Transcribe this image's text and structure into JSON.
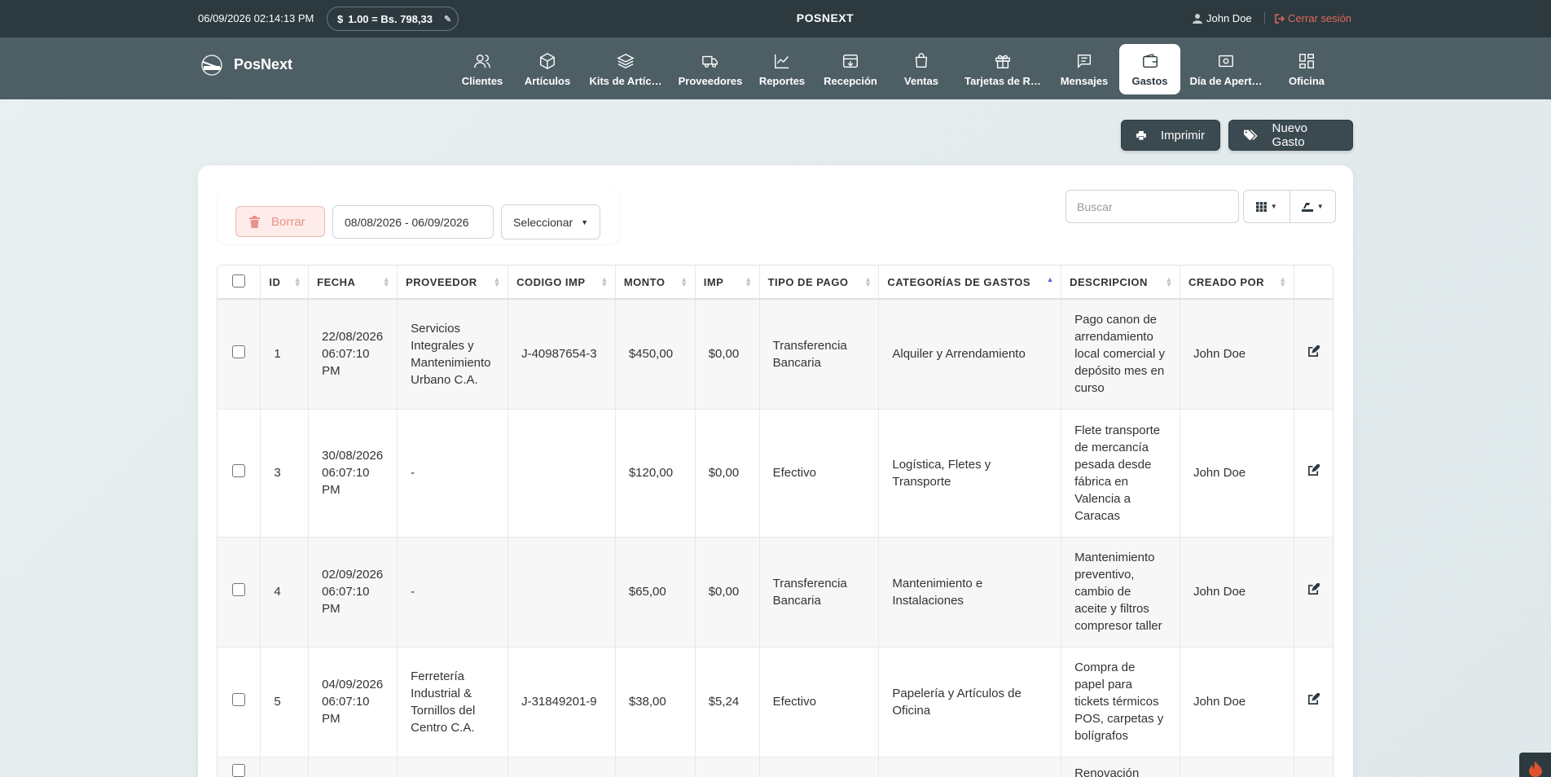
{
  "topbar": {
    "datetime": "06/09/2026 02:14:13 PM",
    "rate_symbol": "$",
    "rate": "1.00 = Bs. 798,33",
    "app_title": "POSNEXT",
    "user_name": "John Doe",
    "logout_label": "Cerrar sesión"
  },
  "brand": {
    "name": "PosNext"
  },
  "nav": [
    {
      "label": "Clientes",
      "icon": "users-icon"
    },
    {
      "label": "Artículos",
      "icon": "box-icon"
    },
    {
      "label": "Kits de Artíc…",
      "icon": "layers-icon"
    },
    {
      "label": "Proveedores",
      "icon": "truck-icon"
    },
    {
      "label": "Reportes",
      "icon": "chart-icon"
    },
    {
      "label": "Recepción",
      "icon": "inbox-icon"
    },
    {
      "label": "Ventas",
      "icon": "cart-icon"
    },
    {
      "label": "Tarjetas de R…",
      "icon": "gift-icon"
    },
    {
      "label": "Mensajes",
      "icon": "message-icon"
    },
    {
      "label": "Gastos",
      "icon": "wallet-icon"
    },
    {
      "label": "Día de Apert…",
      "icon": "cash-icon"
    },
    {
      "label": "Oficina",
      "icon": "grid-icon"
    }
  ],
  "actions": {
    "print_label": "Imprimir",
    "new_label": "Nuevo Gasto"
  },
  "filters": {
    "delete_label": "Borrar",
    "date_range": "08/08/2026 - 06/09/2026",
    "select_label": "Seleccionar",
    "search_placeholder": "Buscar"
  },
  "table": {
    "headers": [
      "ID",
      "FECHA",
      "PROVEEDOR",
      "CODIGO IMP",
      "MONTO",
      "IMP",
      "TIPO DE PAGO",
      "CATEGORÍAS DE GASTOS",
      "DESCRIPCION",
      "CREADO POR"
    ],
    "rows": [
      {
        "id": "1",
        "fecha": "22/08/2026 06:07:10 PM",
        "proveedor": "Servicios Integrales y Mantenimiento Urbano C.A.",
        "codigo": "J-40987654-3",
        "monto": "$450,00",
        "imp": "$0,00",
        "pago": "Transferencia Bancaria",
        "categoria": "Alquiler y Arrendamiento",
        "descripcion": "Pago canon de arrendamiento local comercial y depósito mes en curso",
        "creado": "John Doe"
      },
      {
        "id": "3",
        "fecha": "30/08/2026 06:07:10 PM",
        "proveedor": "-",
        "codigo": "",
        "monto": "$120,00",
        "imp": "$0,00",
        "pago": "Efectivo",
        "categoria": "Logística, Fletes y Transporte",
        "descripcion": "Flete transporte de mercancía pesada desde fábrica en Valencia a Caracas",
        "creado": "John Doe"
      },
      {
        "id": "4",
        "fecha": "02/09/2026 06:07:10 PM",
        "proveedor": "-",
        "codigo": "",
        "monto": "$65,00",
        "imp": "$0,00",
        "pago": "Transferencia Bancaria",
        "categoria": "Mantenimiento e Instalaciones",
        "descripcion": "Mantenimiento preventivo, cambio de aceite y filtros compresor taller",
        "creado": "John Doe"
      },
      {
        "id": "5",
        "fecha": "04/09/2026 06:07:10 PM",
        "proveedor": "Ferretería Industrial & Tornillos del Centro C.A.",
        "codigo": "J-31849201-9",
        "monto": "$38,00",
        "imp": "$5,24",
        "pago": "Efectivo",
        "categoria": "Papelería y Artículos de Oficina",
        "descripcion": "Compra de papel para tickets térmicos POS, carpetas y bolígrafos",
        "creado": "John Doe"
      },
      {
        "id": "",
        "fecha": "",
        "proveedor": "",
        "codigo": "",
        "monto": "",
        "imp": "",
        "pago": "",
        "categoria": "",
        "descripcion": "Renovación",
        "creado": ""
      }
    ]
  }
}
